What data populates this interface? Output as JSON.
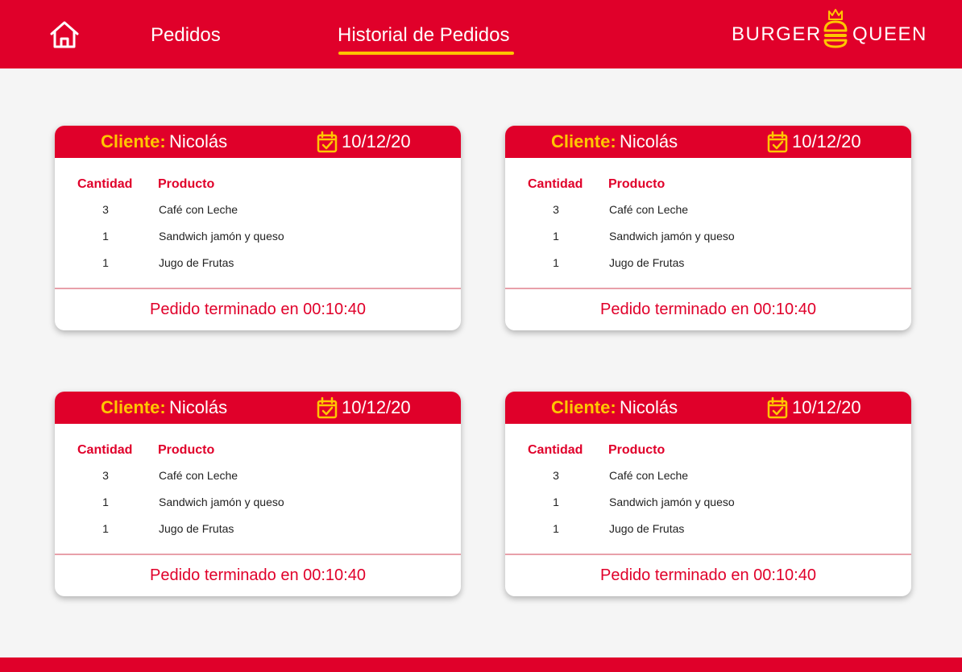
{
  "header": {
    "nav_pedidos": "Pedidos",
    "nav_historial": "Historial de Pedidos",
    "logo_left": "BURGER",
    "logo_right": "QUEEN",
    "icons": {
      "home": "home-icon",
      "logo": "burger-crown-icon",
      "calendar": "calendar-check-icon"
    }
  },
  "colors": {
    "brand_red": "#e0002a",
    "accent_yellow": "#ffc600",
    "background": "#f5f5f5"
  },
  "orders": [
    {
      "client_label": "Cliente:",
      "client_name": "Nicolás",
      "date": "10/12/20",
      "qty_header": "Cantidad",
      "product_header": "Producto",
      "items": [
        {
          "qty": "3",
          "product": "Café con Leche"
        },
        {
          "qty": "1",
          "product": "Sandwich jamón y queso"
        },
        {
          "qty": "1",
          "product": "Jugo de Frutas"
        }
      ],
      "footer": "Pedido terminado en 00:10:40"
    },
    {
      "client_label": "Cliente:",
      "client_name": "Nicolás",
      "date": "10/12/20",
      "qty_header": "Cantidad",
      "product_header": "Producto",
      "items": [
        {
          "qty": "3",
          "product": "Café con Leche"
        },
        {
          "qty": "1",
          "product": "Sandwich jamón y queso"
        },
        {
          "qty": "1",
          "product": "Jugo de Frutas"
        }
      ],
      "footer": "Pedido terminado en 00:10:40"
    },
    {
      "client_label": "Cliente:",
      "client_name": "Nicolás",
      "date": "10/12/20",
      "qty_header": "Cantidad",
      "product_header": "Producto",
      "items": [
        {
          "qty": "3",
          "product": "Café con Leche"
        },
        {
          "qty": "1",
          "product": "Sandwich jamón y queso"
        },
        {
          "qty": "1",
          "product": "Jugo de Frutas"
        }
      ],
      "footer": "Pedido terminado en 00:10:40"
    },
    {
      "client_label": "Cliente:",
      "client_name": "Nicolás",
      "date": "10/12/20",
      "qty_header": "Cantidad",
      "product_header": "Producto",
      "items": [
        {
          "qty": "3",
          "product": "Café con Leche"
        },
        {
          "qty": "1",
          "product": "Sandwich jamón y queso"
        },
        {
          "qty": "1",
          "product": "Jugo de Frutas"
        }
      ],
      "footer": "Pedido terminado en 00:10:40"
    }
  ]
}
